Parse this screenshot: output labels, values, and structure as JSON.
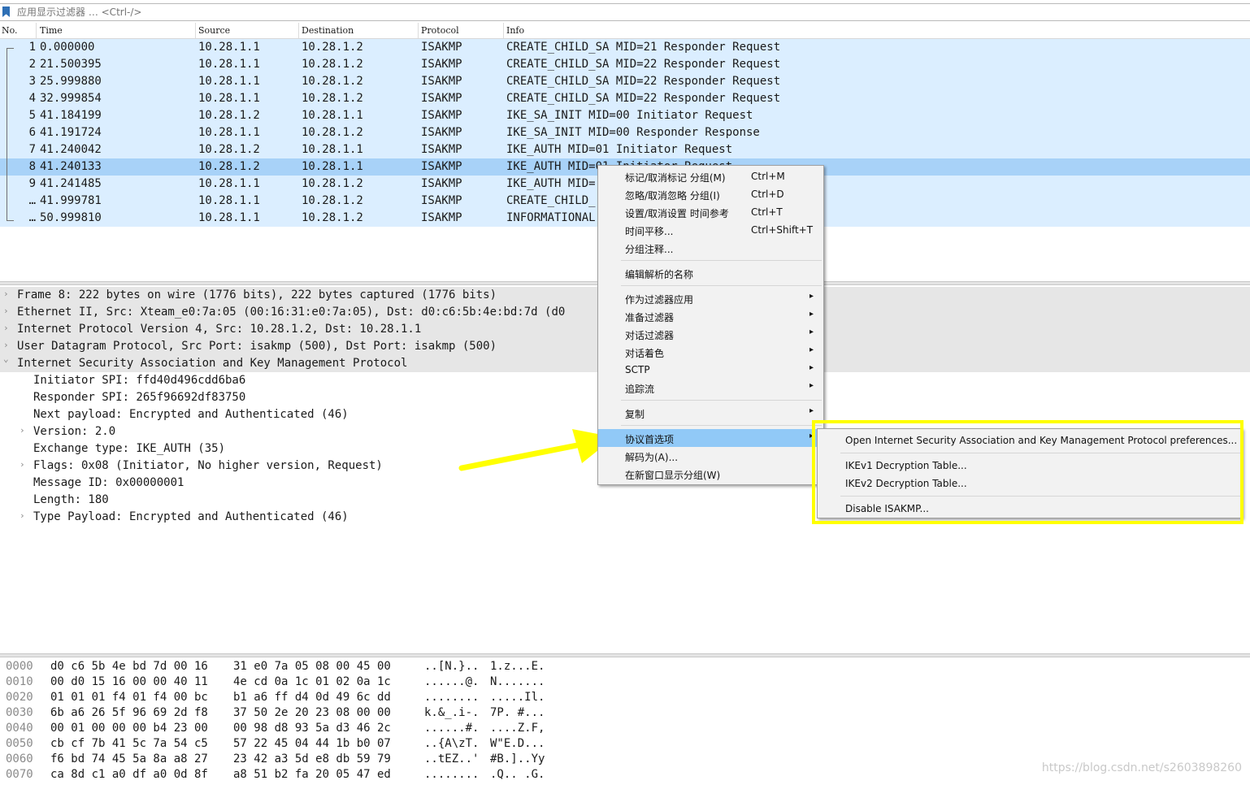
{
  "filter": {
    "placeholder": "应用显示过滤器 … <Ctrl-/>"
  },
  "columns": [
    "No.",
    "Time",
    "Source",
    "Destination",
    "Protocol",
    "Info"
  ],
  "packets": [
    {
      "no": "1",
      "time": "0.000000",
      "src": "10.28.1.1",
      "dst": "10.28.1.2",
      "proto": "ISAKMP",
      "info": "CREATE_CHILD_SA MID=21 Responder Request"
    },
    {
      "no": "2",
      "time": "21.500395",
      "src": "10.28.1.1",
      "dst": "10.28.1.2",
      "proto": "ISAKMP",
      "info": "CREATE_CHILD_SA MID=22 Responder Request"
    },
    {
      "no": "3",
      "time": "25.999880",
      "src": "10.28.1.1",
      "dst": "10.28.1.2",
      "proto": "ISAKMP",
      "info": "CREATE_CHILD_SA MID=22 Responder Request"
    },
    {
      "no": "4",
      "time": "32.999854",
      "src": "10.28.1.1",
      "dst": "10.28.1.2",
      "proto": "ISAKMP",
      "info": "CREATE_CHILD_SA MID=22 Responder Request"
    },
    {
      "no": "5",
      "time": "41.184199",
      "src": "10.28.1.2",
      "dst": "10.28.1.1",
      "proto": "ISAKMP",
      "info": "IKE_SA_INIT MID=00 Initiator Request"
    },
    {
      "no": "6",
      "time": "41.191724",
      "src": "10.28.1.1",
      "dst": "10.28.1.2",
      "proto": "ISAKMP",
      "info": "IKE_SA_INIT MID=00 Responder Response"
    },
    {
      "no": "7",
      "time": "41.240042",
      "src": "10.28.1.2",
      "dst": "10.28.1.1",
      "proto": "ISAKMP",
      "info": "IKE_AUTH MID=01 Initiator Request"
    },
    {
      "no": "8",
      "time": "41.240133",
      "src": "10.28.1.2",
      "dst": "10.28.1.1",
      "proto": "ISAKMP",
      "info": "IKE_AUTH MID=01 Initiator Request"
    },
    {
      "no": "9",
      "time": "41.241485",
      "src": "10.28.1.1",
      "dst": "10.28.1.2",
      "proto": "ISAKMP",
      "info": "IKE_AUTH MID="
    },
    {
      "no": "…",
      "time": "41.999781",
      "src": "10.28.1.1",
      "dst": "10.28.1.2",
      "proto": "ISAKMP",
      "info": "CREATE_CHILD_"
    },
    {
      "no": "…",
      "time": "50.999810",
      "src": "10.28.1.1",
      "dst": "10.28.1.2",
      "proto": "ISAKMP",
      "info": "INFORMATIONAL"
    }
  ],
  "selected_packet": "8",
  "details": [
    {
      "text": "Frame 8: 222 bytes on wire (1776 bits), 222 bytes captured (1776 bits)",
      "indent": 0,
      "expander": "closed"
    },
    {
      "text": "Ethernet II, Src: Xteam_e0:7a:05 (00:16:31:e0:7a:05), Dst: d0:c6:5b:4e:bd:7d (d0",
      "indent": 0,
      "expander": "closed"
    },
    {
      "text": "Internet Protocol Version 4, Src: 10.28.1.2, Dst: 10.28.1.1",
      "indent": 0,
      "expander": "closed"
    },
    {
      "text": "User Datagram Protocol, Src Port: isakmp (500), Dst Port: isakmp (500)",
      "indent": 0,
      "expander": "closed"
    },
    {
      "text": "Internet Security Association and Key Management Protocol",
      "indent": 0,
      "expander": "open"
    },
    {
      "text": "Initiator SPI: ffd40d496cdd6ba6",
      "indent": 1,
      "expander": "none"
    },
    {
      "text": "Responder SPI: 265f96692df83750",
      "indent": 1,
      "expander": "none"
    },
    {
      "text": "Next payload: Encrypted and Authenticated (46)",
      "indent": 1,
      "expander": "none"
    },
    {
      "text": "Version: 2.0",
      "indent": 1,
      "expander": "closed"
    },
    {
      "text": "Exchange type: IKE_AUTH (35)",
      "indent": 1,
      "expander": "none"
    },
    {
      "text": "Flags: 0x08 (Initiator, No higher version, Request)",
      "indent": 1,
      "expander": "closed"
    },
    {
      "text": "Message ID: 0x00000001",
      "indent": 1,
      "expander": "none"
    },
    {
      "text": "Length: 180",
      "indent": 1,
      "expander": "none"
    },
    {
      "text": "Type Payload: Encrypted and Authenticated (46)",
      "indent": 1,
      "expander": "closed"
    }
  ],
  "hex": [
    {
      "off": "0000",
      "b1": "d0 c6 5b 4e bd 7d 00 16",
      "b2": "31 e0 7a 05 08 00 45 00",
      "a1": "..[N.}..",
      "a2": "1.z...E."
    },
    {
      "off": "0010",
      "b1": "00 d0 15 16 00 00 40 11",
      "b2": "4e cd 0a 1c 01 02 0a 1c",
      "a1": "......@.",
      "a2": "N......."
    },
    {
      "off": "0020",
      "b1": "01 01 01 f4 01 f4 00 bc",
      "b2": "b1 a6 ff d4 0d 49 6c dd",
      "a1": "........",
      "a2": ".....Il."
    },
    {
      "off": "0030",
      "b1": "6b a6 26 5f 96 69 2d f8",
      "b2": "37 50 2e 20 23 08 00 00",
      "a1": "k.&_.i-.",
      "a2": "7P. #..."
    },
    {
      "off": "0040",
      "b1": "00 01 00 00 00 b4 23 00",
      "b2": "00 98 d8 93 5a d3 46 2c",
      "a1": "......#.",
      "a2": "....Z.F,"
    },
    {
      "off": "0050",
      "b1": "cb cf 7b 41 5c 7a 54 c5",
      "b2": "57 22 45 04 44 1b b0 07",
      "a1": "..{A\\zT.",
      "a2": "W\"E.D..."
    },
    {
      "off": "0060",
      "b1": "f6 bd 74 45 5a 8a a8 27",
      "b2": "23 42 a3 5d e8 db 59 79",
      "a1": "..tEZ..'",
      "a2": "#B.]..Yy"
    },
    {
      "off": "0070",
      "b1": "ca 8d c1 a0 df a0 0d 8f",
      "b2": "a8 51 b2 fa 20 05 47 ed",
      "a1": "........",
      "a2": ".Q.. .G."
    }
  ],
  "context_menu": {
    "items": [
      {
        "label": "标记/取消标记 分组(M)",
        "shortcut": "Ctrl+M"
      },
      {
        "label": "忽略/取消忽略 分组(I)",
        "shortcut": "Ctrl+D"
      },
      {
        "label": "设置/取消设置 时间参考",
        "shortcut": "Ctrl+T"
      },
      {
        "label": "时间平移...",
        "shortcut": "Ctrl+Shift+T"
      },
      {
        "label": "分组注释...",
        "shortcut": ""
      },
      {
        "sep": true
      },
      {
        "label": "编辑解析的名称",
        "shortcut": ""
      },
      {
        "sep": true
      },
      {
        "label": "作为过滤器应用",
        "submenu": true
      },
      {
        "label": "准备过滤器",
        "submenu": true
      },
      {
        "label": "对话过滤器",
        "submenu": true
      },
      {
        "label": "对话着色",
        "submenu": true
      },
      {
        "label": "SCTP",
        "submenu": true
      },
      {
        "label": "追踪流",
        "submenu": true
      },
      {
        "sep": true
      },
      {
        "label": "复制",
        "submenu": true
      },
      {
        "sep": true
      },
      {
        "label": "协议首选项",
        "submenu": true,
        "highlighted": true
      },
      {
        "label": "解码为(A)...",
        "shortcut": ""
      },
      {
        "label": "在新窗口显示分组(W)",
        "shortcut": ""
      }
    ]
  },
  "submenu": {
    "items": [
      {
        "label": "Open Internet Security Association and Key Management Protocol preferences..."
      },
      {
        "sep": true
      },
      {
        "label": "IKEv1 Decryption Table..."
      },
      {
        "label": "IKEv2 Decryption Table..."
      },
      {
        "sep": true
      },
      {
        "label": "Disable ISAKMP..."
      }
    ]
  },
  "annotation_colors": {
    "highlight_box": "#ffff00",
    "arrow": "#ffff00"
  },
  "watermark": "https://blog.csdn.net/s2603898260"
}
